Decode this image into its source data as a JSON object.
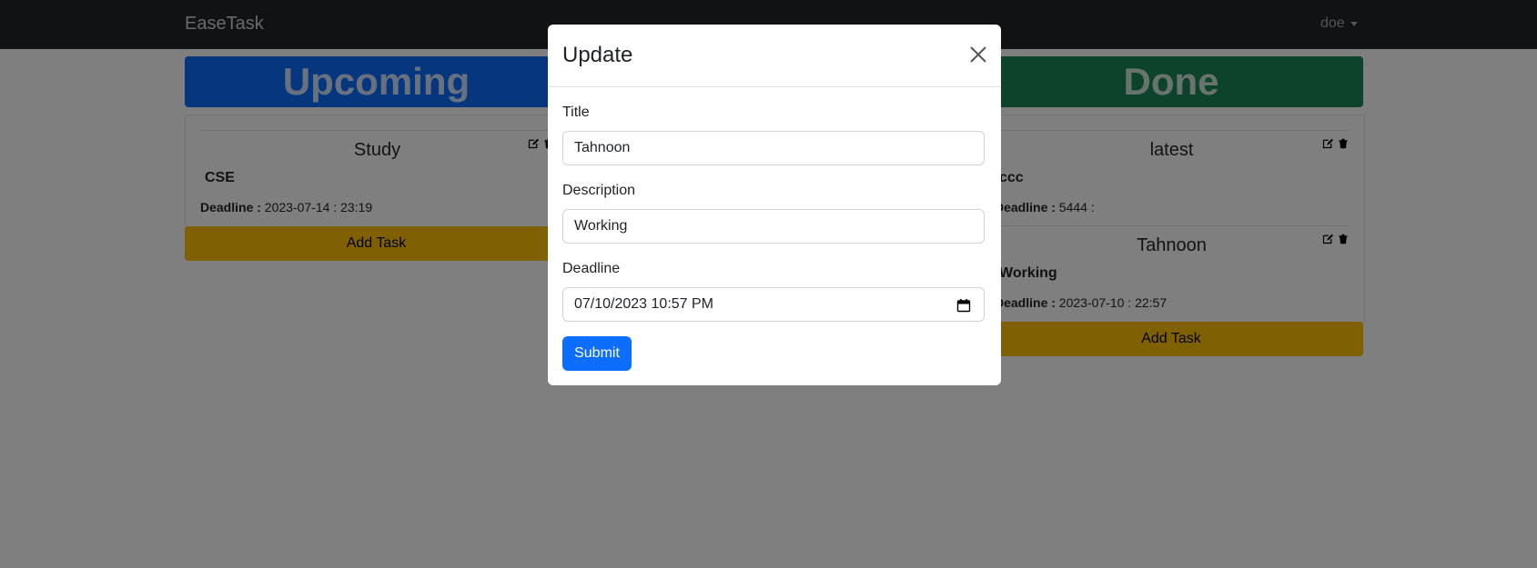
{
  "navbar": {
    "brand": "EaseTask",
    "user": "doe"
  },
  "columns": [
    {
      "title": "Upcoming",
      "tasks": [
        {
          "title": "Study",
          "description": "CSE",
          "deadline_label": "Deadline :",
          "deadline": "2023-07-14 : 23:19"
        }
      ],
      "add_label": "Add Task"
    },
    {
      "title": "Done",
      "tasks": [
        {
          "title": "latest",
          "description": "ccc",
          "deadline_label": "Deadline :",
          "deadline": "5444 :"
        },
        {
          "title": "Tahnoon",
          "description": "Working",
          "deadline_label": "Deadline :",
          "deadline": "2023-07-10 : 22:57"
        }
      ],
      "add_label": "Add Task"
    }
  ],
  "modal": {
    "title": "Update",
    "fields": {
      "title_label": "Title",
      "title_value": "Tahnoon",
      "description_label": "Description",
      "description_value": "Working",
      "deadline_label": "Deadline",
      "deadline_value": "07/10/2023 10:57  PM"
    },
    "submit_label": "Submit"
  },
  "colors": {
    "upcoming": "#0d6efd",
    "done": "#198754",
    "add_task": "#ffc107",
    "primary": "#0d6efd",
    "navbar": "#212529"
  },
  "icons": [
    "edit-icon",
    "trash-icon",
    "close-icon",
    "calendar-icon"
  ]
}
